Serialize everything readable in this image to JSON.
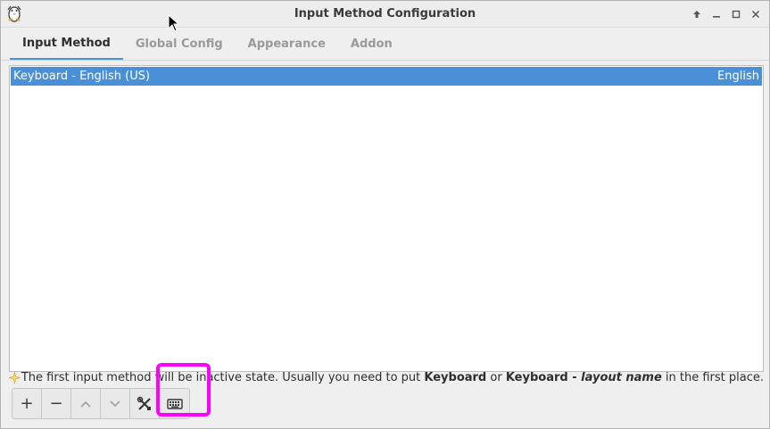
{
  "window": {
    "title": "Input Method Configuration"
  },
  "tabs": [
    {
      "label": "Input Method",
      "active": true
    },
    {
      "label": "Global Config",
      "active": false
    },
    {
      "label": "Appearance",
      "active": false
    },
    {
      "label": "Addon",
      "active": false
    }
  ],
  "list": {
    "rows": [
      {
        "name": "Keyboard - English (US)",
        "language": "English",
        "selected": true
      }
    ]
  },
  "hint": {
    "part1": "The first input method will be inactive state. Usually you need to put ",
    "bold1": "Keyboard",
    "part2": " or ",
    "bold2": "Keyboard - ",
    "bold_italic": "layout name",
    "part3": " in the first place."
  },
  "toolbar": {
    "add_label": "+",
    "remove_label": "−"
  },
  "colors": {
    "accent": "#4a90d9",
    "highlight": "#ff00ff"
  },
  "icons": [
    "app-icon",
    "pin-icon",
    "minimize-icon",
    "maximize-icon",
    "close-icon",
    "chevron-up-icon",
    "chevron-down-icon",
    "tools-icon",
    "keyboard-icon",
    "star-icon",
    "mouse-cursor-icon"
  ]
}
